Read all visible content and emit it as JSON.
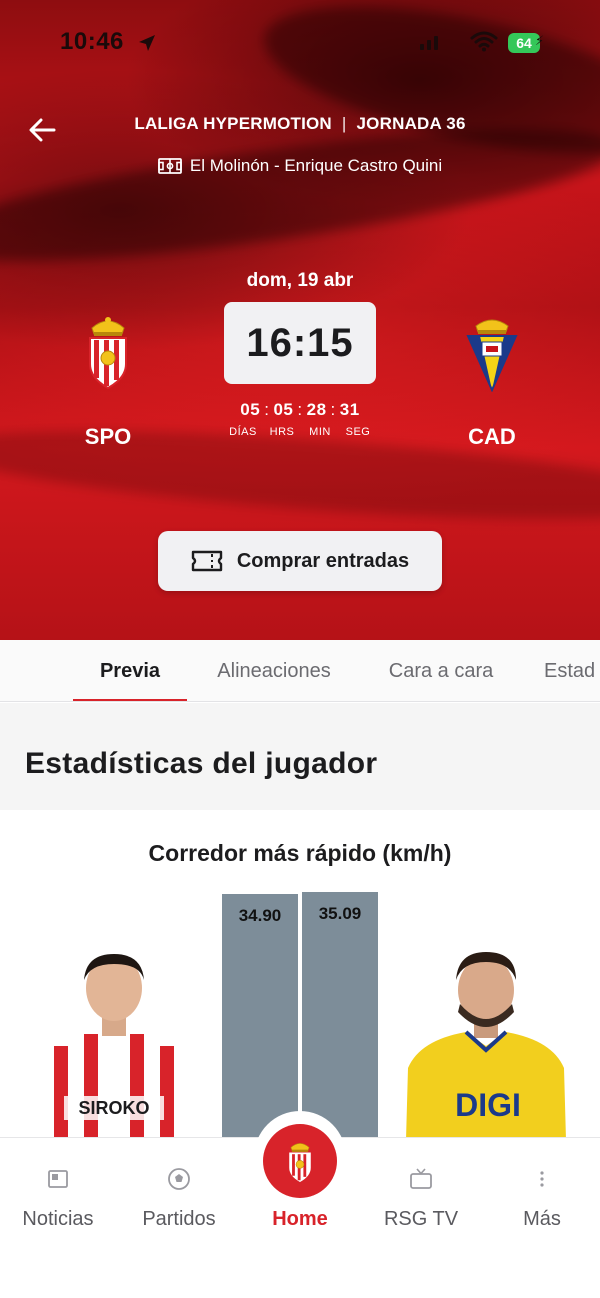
{
  "status_bar": {
    "time": "10:46",
    "battery": "64"
  },
  "header": {
    "competition": "LALIGA HYPERMOTION",
    "separator": "|",
    "round": "JORNADA 36",
    "venue": "El Molinón - Enrique Castro Quini"
  },
  "match": {
    "date": "dom, 19 abr",
    "kickoff": "16:15",
    "home": {
      "abbr": "SPO",
      "crest": "sporting-crest-icon"
    },
    "away": {
      "abbr": "CAD",
      "crest": "cadiz-crest-icon"
    },
    "countdown": {
      "days": "05",
      "hours": "05",
      "minutes": "28",
      "seconds": "31",
      "labels": {
        "days": "DÍAS",
        "hours": "HRS",
        "minutes": "MIN",
        "seconds": "SEG"
      }
    }
  },
  "buy_button": {
    "label": "Comprar entradas",
    "icon": "ticket-icon"
  },
  "tabs": [
    {
      "label": "Previa",
      "active": true
    },
    {
      "label": "Alineaciones",
      "active": false
    },
    {
      "label": "Cara a cara",
      "active": false
    },
    {
      "label": "Estad",
      "active": false
    }
  ],
  "section": {
    "title": "Estadísticas del jugador"
  },
  "player_stat": {
    "label": "Corredor más rápido (km/h)",
    "home_value": "34.90",
    "away_value": "35.09",
    "home_shirt_text": "SIROKO",
    "away_shirt_text": "DIGI"
  },
  "bottom_nav": [
    {
      "label": "Noticias",
      "icon": "news-icon",
      "active": false
    },
    {
      "label": "Partidos",
      "icon": "football-icon",
      "active": false
    },
    {
      "label": "Home",
      "icon": "home-crest-icon",
      "active": true
    },
    {
      "label": "RSG TV",
      "icon": "tv-icon",
      "active": false
    },
    {
      "label": "Más",
      "icon": "more-dots-icon",
      "active": false
    }
  ],
  "colors": {
    "accent": "#d8232a",
    "bar": "#7d8d99",
    "hero_red": "#c8141a",
    "battery_green": "#34c759"
  }
}
